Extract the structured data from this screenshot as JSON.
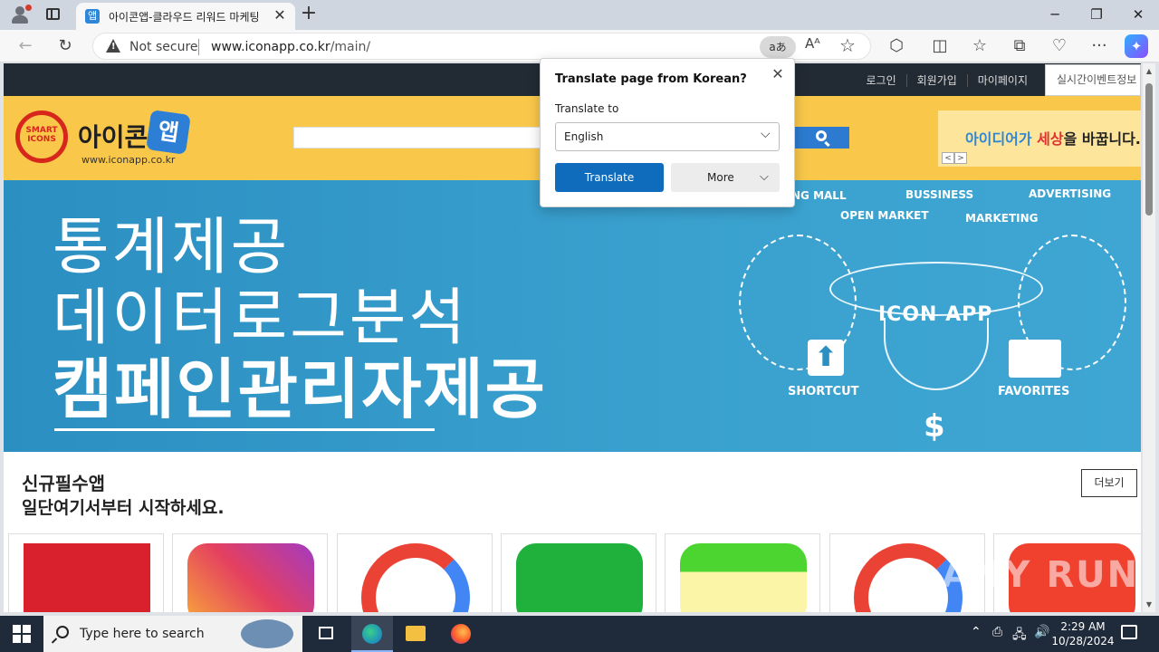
{
  "browser": {
    "tab": {
      "favicon": "앱",
      "title": "아이콘앱-클라우드 리워드 마케팅",
      "close": "✕"
    },
    "new_tab": "+",
    "window_controls": {
      "minimize": "─",
      "maximize": "❐",
      "close": "✕"
    },
    "address": {
      "security_label": "Not secure",
      "url_host": "www.iconapp.co.kr",
      "url_path": "/main/",
      "translate_glyph": "aあ",
      "read_aloud_glyph": "Aᴬ",
      "star_glyph": "☆"
    },
    "toolbar_icons": {
      "back": "←",
      "refresh": "↻",
      "extensions": "⬡",
      "split": "◫",
      "favorites": "☆",
      "collections": "⧉",
      "health": "♡",
      "menu": "···",
      "copilot": "✦"
    }
  },
  "site": {
    "top_links": [
      "로그인",
      "회원가입",
      "마이페이지"
    ],
    "realtime_box": "실시간이벤트정보",
    "logo": {
      "ring_text": "SMART ICONS",
      "name": "아이콘",
      "app": "앱",
      "domain": "www.iconapp.co.kr"
    },
    "banner_right": {
      "text_a": "아이디어가 ",
      "text_b": "세상",
      "text_c": "을 바꿉니다.",
      "prev": "<",
      "next": ">"
    },
    "hero": {
      "line1": "통계제공",
      "line2": "데이터로그분석",
      "line3": "캠페인관리자제공",
      "diagram_labels": {
        "shopping_mall": "NG MALL",
        "business": "BUSSINESS",
        "advertising": "ADVERTISING",
        "open_market": "OPEN MARKET",
        "marketing": "MARKETING",
        "funnel": "ICON APP",
        "shortcut": "SHORTCUT",
        "favorites": "FAVORITES",
        "dollar": "$"
      }
    },
    "section": {
      "title": "신규필수앱",
      "subtitle": "일단여기서부터 시작하세요.",
      "more": "더보기"
    }
  },
  "translate_popup": {
    "title": "Translate page from Korean?",
    "close": "✕",
    "label": "Translate to",
    "selected_language": "English",
    "translate_button": "Translate",
    "more_button": "More"
  },
  "watermark": "ANY RUN",
  "taskbar": {
    "search_placeholder": "Type here to search",
    "clock_time": "2:29 AM",
    "clock_date": "10/28/2024"
  },
  "colors": {
    "accent": "#0f6cbd",
    "site_yellow": "#f9c84a",
    "hero_blue": "#2b8fc1",
    "topbar": "#222a33"
  }
}
